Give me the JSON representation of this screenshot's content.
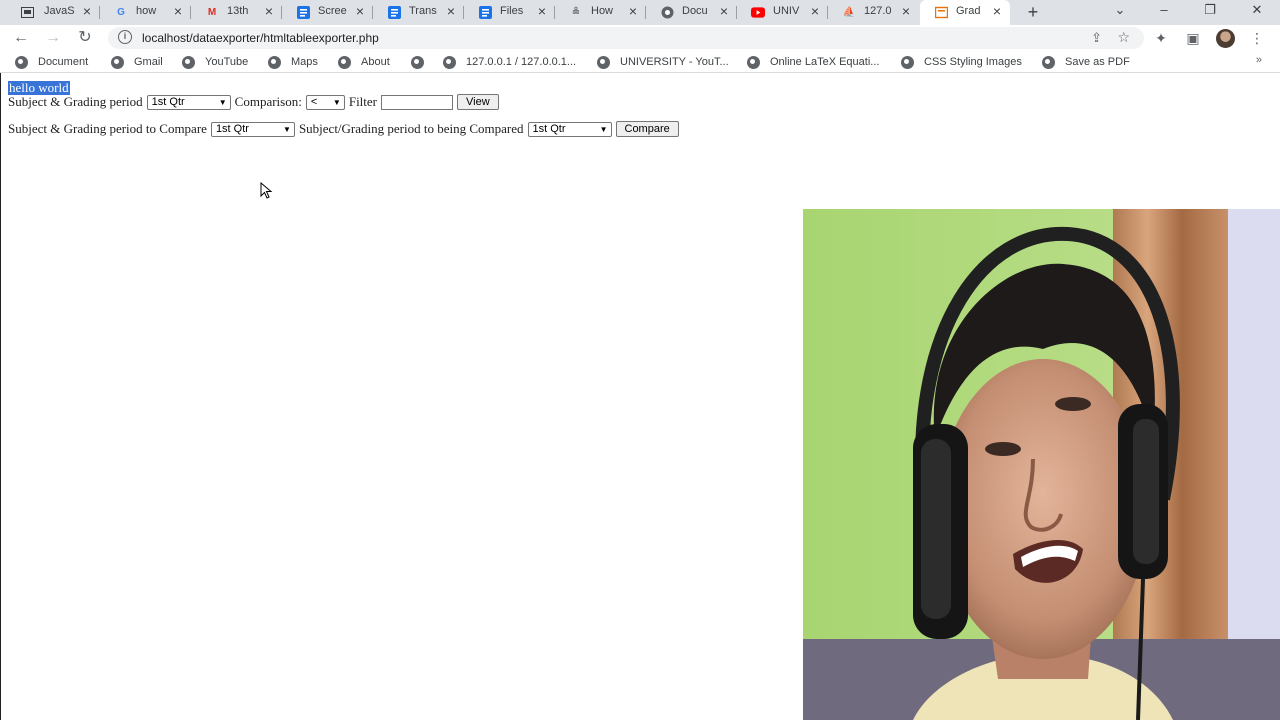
{
  "tabs": [
    {
      "title": "JavaS",
      "icon": "code-icon"
    },
    {
      "title": "how",
      "icon": "google-icon"
    },
    {
      "title": "13th",
      "icon": "gmail-icon"
    },
    {
      "title": "Scree",
      "icon": "docs-icon"
    },
    {
      "title": "Trans",
      "icon": "docs-icon"
    },
    {
      "title": "Files",
      "icon": "docs-icon"
    },
    {
      "title": "How",
      "icon": "page-icon"
    },
    {
      "title": "Docu",
      "icon": "globe-icon"
    },
    {
      "title": "UNIV",
      "icon": "youtube-icon"
    },
    {
      "title": "127.0",
      "icon": "phpmyadmin-icon"
    },
    {
      "title": "Grad",
      "icon": "page-icon",
      "active": true
    }
  ],
  "omnibox": {
    "url": "localhost/dataexporter/htmltableexporter.php"
  },
  "bookmarks": [
    {
      "label": "Document"
    },
    {
      "label": "Gmail"
    },
    {
      "label": "YouTube"
    },
    {
      "label": "Maps"
    },
    {
      "label": "About"
    },
    {
      "label": ""
    },
    {
      "label": "127.0.0.1 / 127.0.0.1..."
    },
    {
      "label": "UNIVERSITY - YouT..."
    },
    {
      "label": "Online LaTeX Equati..."
    },
    {
      "label": "CSS Styling Images"
    },
    {
      "label": "Save as PDF"
    }
  ],
  "page": {
    "selected_text": "hello world",
    "row1": {
      "subject_label": "Subject & Grading period",
      "subject_value": "1st Qtr",
      "comparison_label": "Comparison:",
      "comparison_value": "<",
      "filter_label": "Filter",
      "filter_value": "",
      "view_button": "View"
    },
    "row2": {
      "compare_label": "Subject & Grading period to Compare",
      "compare_value": "1st Qtr",
      "compared_label": "Subject/Grading period to being Compared",
      "compared_value": "1st Qtr",
      "compare_button": "Compare"
    }
  }
}
